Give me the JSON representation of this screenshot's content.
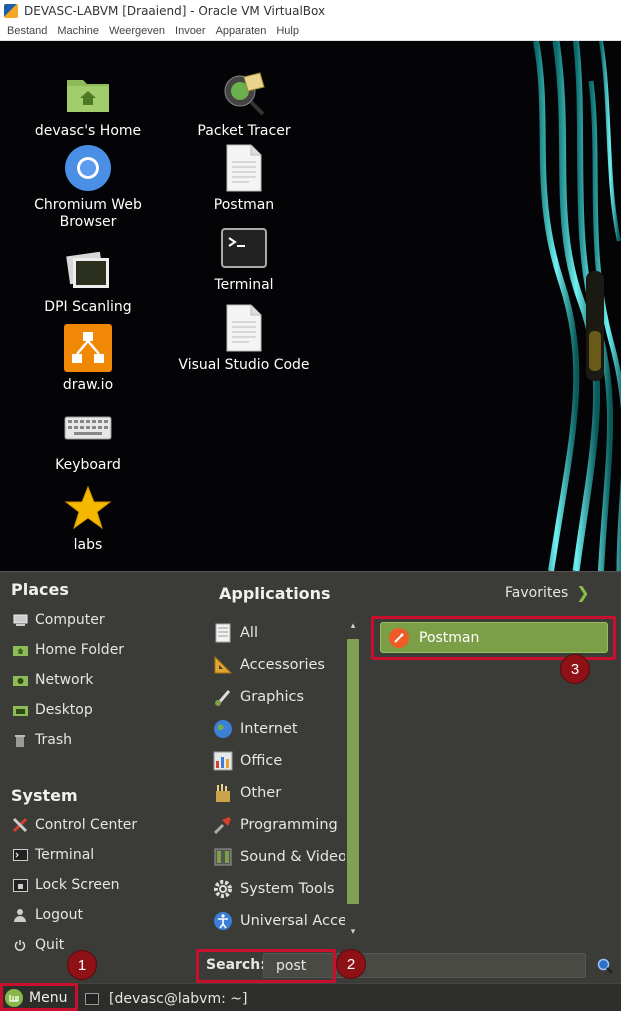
{
  "window": {
    "title": "DEVASC-LABVM [Draaiend] - Oracle VM VirtualBox",
    "menus": [
      "Bestand",
      "Machine",
      "Weergeven",
      "Invoer",
      "Apparaten",
      "Hulp"
    ]
  },
  "desktop_icons": [
    {
      "label": "devasc's Home",
      "icon": "home-folder-icon"
    },
    {
      "label": "Chromium Web Browser",
      "icon": "chromium-icon"
    },
    {
      "label": "DPI Scanling",
      "icon": "photos-icon"
    },
    {
      "label": "draw.io",
      "icon": "drawio-icon"
    },
    {
      "label": "Keyboard",
      "icon": "keyboard-icon"
    },
    {
      "label": "labs",
      "icon": "star-icon"
    },
    {
      "label": "Packet Tracer",
      "icon": "packet-tracer-icon"
    },
    {
      "label": "Postman",
      "icon": "document-icon"
    },
    {
      "label": "Terminal",
      "icon": "terminal-icon"
    },
    {
      "label": "Visual Studio Code",
      "icon": "document-icon"
    }
  ],
  "menu": {
    "places_title": "Places",
    "places": [
      "Computer",
      "Home Folder",
      "Network",
      "Desktop",
      "Trash"
    ],
    "system_title": "System",
    "system": [
      "Control Center",
      "Terminal",
      "Lock Screen",
      "Logout",
      "Quit"
    ],
    "applications_title": "Applications",
    "categories": [
      "All",
      "Accessories",
      "Graphics",
      "Internet",
      "Office",
      "Other",
      "Programming",
      "Sound & Video",
      "System Tools",
      "Universal Access"
    ],
    "favorites_label": "Favorites",
    "result_label": "Postman",
    "search_label": "Search:",
    "search_value": "post"
  },
  "taskbar": {
    "menu_label": "Menu",
    "window_label": "[devasc@labvm: ~]"
  },
  "annotations": [
    "1",
    "2",
    "3"
  ],
  "colors": {
    "highlight": "#c8102e",
    "accent_green": "#7b9f47",
    "panel": "#3b3b37"
  }
}
